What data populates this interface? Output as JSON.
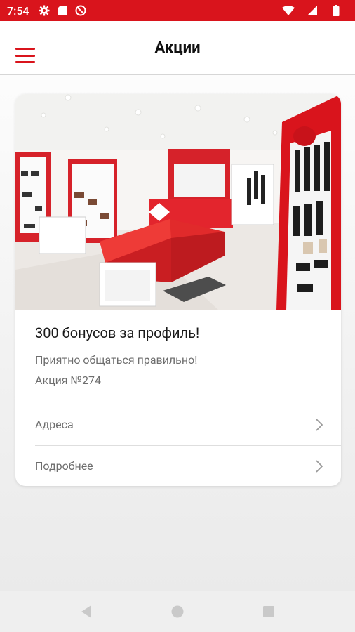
{
  "status_bar": {
    "time": "7:54",
    "icons": [
      "gear-icon",
      "sd-card-icon",
      "no-disturb-icon",
      "wifi-icon",
      "signal-icon",
      "battery-icon"
    ],
    "color": "#d9141c"
  },
  "app_bar": {
    "title": "Акции",
    "menu_icon": "hamburger-menu-icon",
    "accent": "#d9141c"
  },
  "promo": {
    "image": "store-interior-photo",
    "title": "300 бонусов за профиль!",
    "subtitle": "Приятно общаться правильно!",
    "number": "Акция №274",
    "rows": [
      {
        "label": "Адреса",
        "icon": "chevron-right-icon"
      },
      {
        "label": "Подробнее",
        "icon": "chevron-right-icon"
      }
    ]
  },
  "nav_bar": {
    "buttons": [
      "back-icon",
      "home-icon",
      "recents-icon"
    ]
  }
}
